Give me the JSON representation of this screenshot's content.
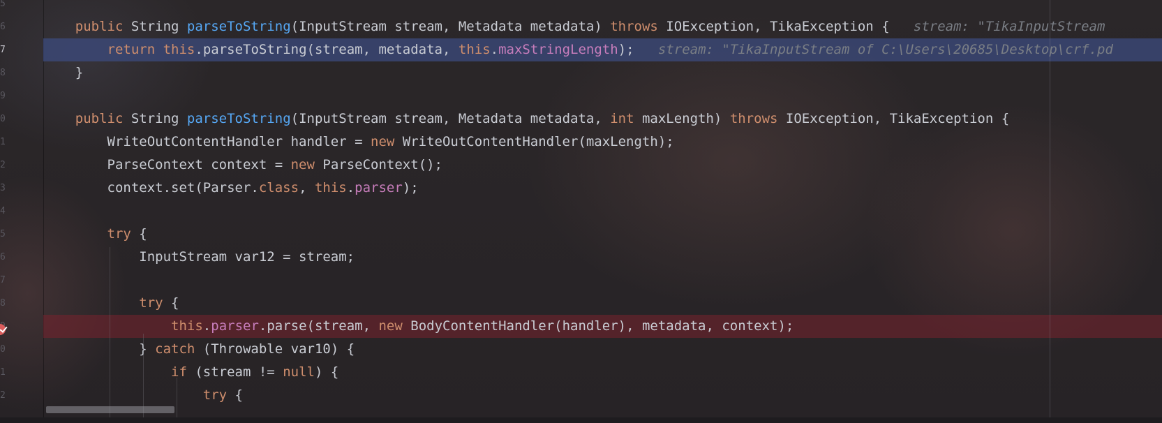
{
  "gutter": {
    "line_numbers": [
      "5",
      "6",
      "7",
      "8",
      "9",
      "0",
      "1",
      "2",
      "3",
      "4",
      "5",
      "6",
      "7",
      "8",
      "9",
      "0",
      "1",
      "2"
    ],
    "current_index": 2
  },
  "lines": [
    {
      "kind": "blank",
      "tokens": []
    },
    {
      "kind": "normal",
      "tokens": [
        {
          "t": "    "
        },
        {
          "t": "public",
          "c": "kw"
        },
        {
          "t": " String "
        },
        {
          "t": "parseToString",
          "c": "fn"
        },
        {
          "t": "(InputStream stream, Metadata metadata) "
        },
        {
          "t": "throws",
          "c": "kw"
        },
        {
          "t": " IOException, TikaException {   "
        },
        {
          "t": "stream: \"TikaInputStream",
          "c": "hint"
        }
      ]
    },
    {
      "kind": "exec",
      "tokens": [
        {
          "t": "        "
        },
        {
          "t": "return",
          "c": "kw"
        },
        {
          "t": " "
        },
        {
          "t": "this",
          "c": "kw"
        },
        {
          "t": ".parseToString(stream, metadata, "
        },
        {
          "t": "this",
          "c": "kw"
        },
        {
          "t": "."
        },
        {
          "t": "maxStringLength",
          "c": "field"
        },
        {
          "t": ");   "
        },
        {
          "t": "stream: \"TikaInputStream of C:\\Users\\20685\\Desktop\\crf.pd",
          "c": "hint"
        }
      ]
    },
    {
      "kind": "normal",
      "tokens": [
        {
          "t": "    }"
        }
      ]
    },
    {
      "kind": "blank",
      "tokens": []
    },
    {
      "kind": "normal",
      "tokens": [
        {
          "t": "    "
        },
        {
          "t": "public",
          "c": "kw"
        },
        {
          "t": " String "
        },
        {
          "t": "parseToString",
          "c": "fn"
        },
        {
          "t": "(InputStream stream, Metadata metadata, "
        },
        {
          "t": "int",
          "c": "kw"
        },
        {
          "t": " maxLength) "
        },
        {
          "t": "throws",
          "c": "kw"
        },
        {
          "t": " IOException, TikaException {"
        }
      ]
    },
    {
      "kind": "normal",
      "tokens": [
        {
          "t": "        WriteOutContentHandler handler = "
        },
        {
          "t": "new",
          "c": "kw"
        },
        {
          "t": " WriteOutContentHandler(maxLength);"
        }
      ]
    },
    {
      "kind": "normal",
      "tokens": [
        {
          "t": "        ParseContext context = "
        },
        {
          "t": "new",
          "c": "kw"
        },
        {
          "t": " ParseContext();"
        }
      ]
    },
    {
      "kind": "normal",
      "tokens": [
        {
          "t": "        context.set(Parser."
        },
        {
          "t": "class",
          "c": "kw"
        },
        {
          "t": ", "
        },
        {
          "t": "this",
          "c": "kw"
        },
        {
          "t": "."
        },
        {
          "t": "parser",
          "c": "field"
        },
        {
          "t": ");"
        }
      ]
    },
    {
      "kind": "blank",
      "tokens": []
    },
    {
      "kind": "normal",
      "tokens": [
        {
          "t": "        "
        },
        {
          "t": "try",
          "c": "kw"
        },
        {
          "t": " {"
        }
      ]
    },
    {
      "kind": "normal",
      "tokens": [
        {
          "t": "            InputStream var12 = stream;"
        }
      ]
    },
    {
      "kind": "blank",
      "tokens": []
    },
    {
      "kind": "normal",
      "tokens": [
        {
          "t": "            "
        },
        {
          "t": "try",
          "c": "kw"
        },
        {
          "t": " {"
        }
      ]
    },
    {
      "kind": "breakpoint",
      "tokens": [
        {
          "t": "                "
        },
        {
          "t": "this",
          "c": "kw"
        },
        {
          "t": "."
        },
        {
          "t": "parser",
          "c": "field"
        },
        {
          "t": ".parse(stream, "
        },
        {
          "t": "new",
          "c": "kw"
        },
        {
          "t": " BodyContentHandler(handler), metadata, context);"
        }
      ]
    },
    {
      "kind": "normal",
      "tokens": [
        {
          "t": "            } "
        },
        {
          "t": "catch",
          "c": "kw"
        },
        {
          "t": " (Throwable var10) {"
        }
      ]
    },
    {
      "kind": "normal",
      "tokens": [
        {
          "t": "                "
        },
        {
          "t": "if",
          "c": "kw"
        },
        {
          "t": " (stream != "
        },
        {
          "t": "null",
          "c": "kw"
        },
        {
          "t": ") {"
        }
      ]
    },
    {
      "kind": "normal",
      "tokens": [
        {
          "t": "                    "
        },
        {
          "t": "try",
          "c": "kw"
        },
        {
          "t": " {"
        }
      ]
    }
  ],
  "colors": {
    "keyword": "#cf8e6d",
    "method": "#56a8f5",
    "field": "#c77dbb",
    "inline_hint": "#7a7e85",
    "exec_highlight": "#3c4b7d",
    "breakpoint_highlight": "#78232d",
    "breakpoint_icon": "#db5c5c"
  },
  "icons": {
    "breakpoint": "breakpoint-check-icon"
  }
}
